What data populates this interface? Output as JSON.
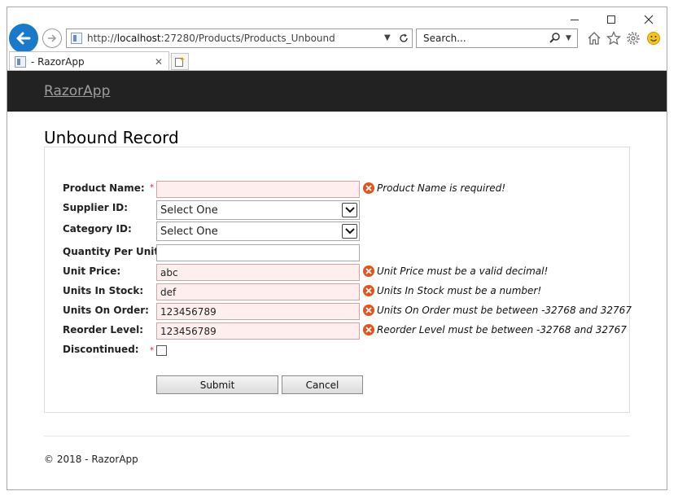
{
  "browser": {
    "address": {
      "scheme": "http://",
      "host": "localhost",
      "rest": ":27280/Products/Products_Unbound"
    },
    "search": {
      "placeholder": "Search..."
    },
    "tab": {
      "title": "- RazorApp"
    }
  },
  "app": {
    "brand": "RazorApp",
    "page_title": "Unbound Record",
    "form": {
      "required_mark": "*",
      "fields": {
        "product_name": {
          "label": "Product Name:",
          "value": "",
          "error": "Product Name is required!"
        },
        "supplier_id": {
          "label": "Supplier ID:",
          "selected": "Select One"
        },
        "category_id": {
          "label": "Category ID:",
          "selected": "Select One"
        },
        "quantity_per_unit": {
          "label": "Quantity Per Unit:",
          "value": ""
        },
        "unit_price": {
          "label": "Unit Price:",
          "value": "abc",
          "error": "Unit Price must be a valid decimal!"
        },
        "units_in_stock": {
          "label": "Units In Stock:",
          "value": "def",
          "error": "Units In Stock must be a number!"
        },
        "units_on_order": {
          "label": "Units On Order:",
          "value": "123456789",
          "error": "Units On Order must be between -32768 and 32767"
        },
        "reorder_level": {
          "label": "Reorder Level:",
          "value": "123456789",
          "error": "Reorder Level must be between -32768 and 32767"
        },
        "discontinued": {
          "label": "Discontinued:",
          "checked": false
        }
      },
      "submit_label": "Submit",
      "cancel_label": "Cancel"
    },
    "footer": "© 2018 - RazorApp"
  },
  "colors": {
    "navbar": "#222222",
    "brand": "#9d9d9d",
    "error_icon": "#e0551d",
    "invalid_field_bg": "#ffeeee",
    "back_button": "#1979ca"
  },
  "icons": [
    "minimize-icon",
    "maximize-icon",
    "close-icon",
    "back-arrow-icon",
    "forward-arrow-icon",
    "page-icon",
    "refresh-icon",
    "search-icon",
    "home-icon",
    "star-icon",
    "gear-icon",
    "smiley-icon",
    "new-tab-icon",
    "error-icon",
    "chevron-down-icon"
  ]
}
